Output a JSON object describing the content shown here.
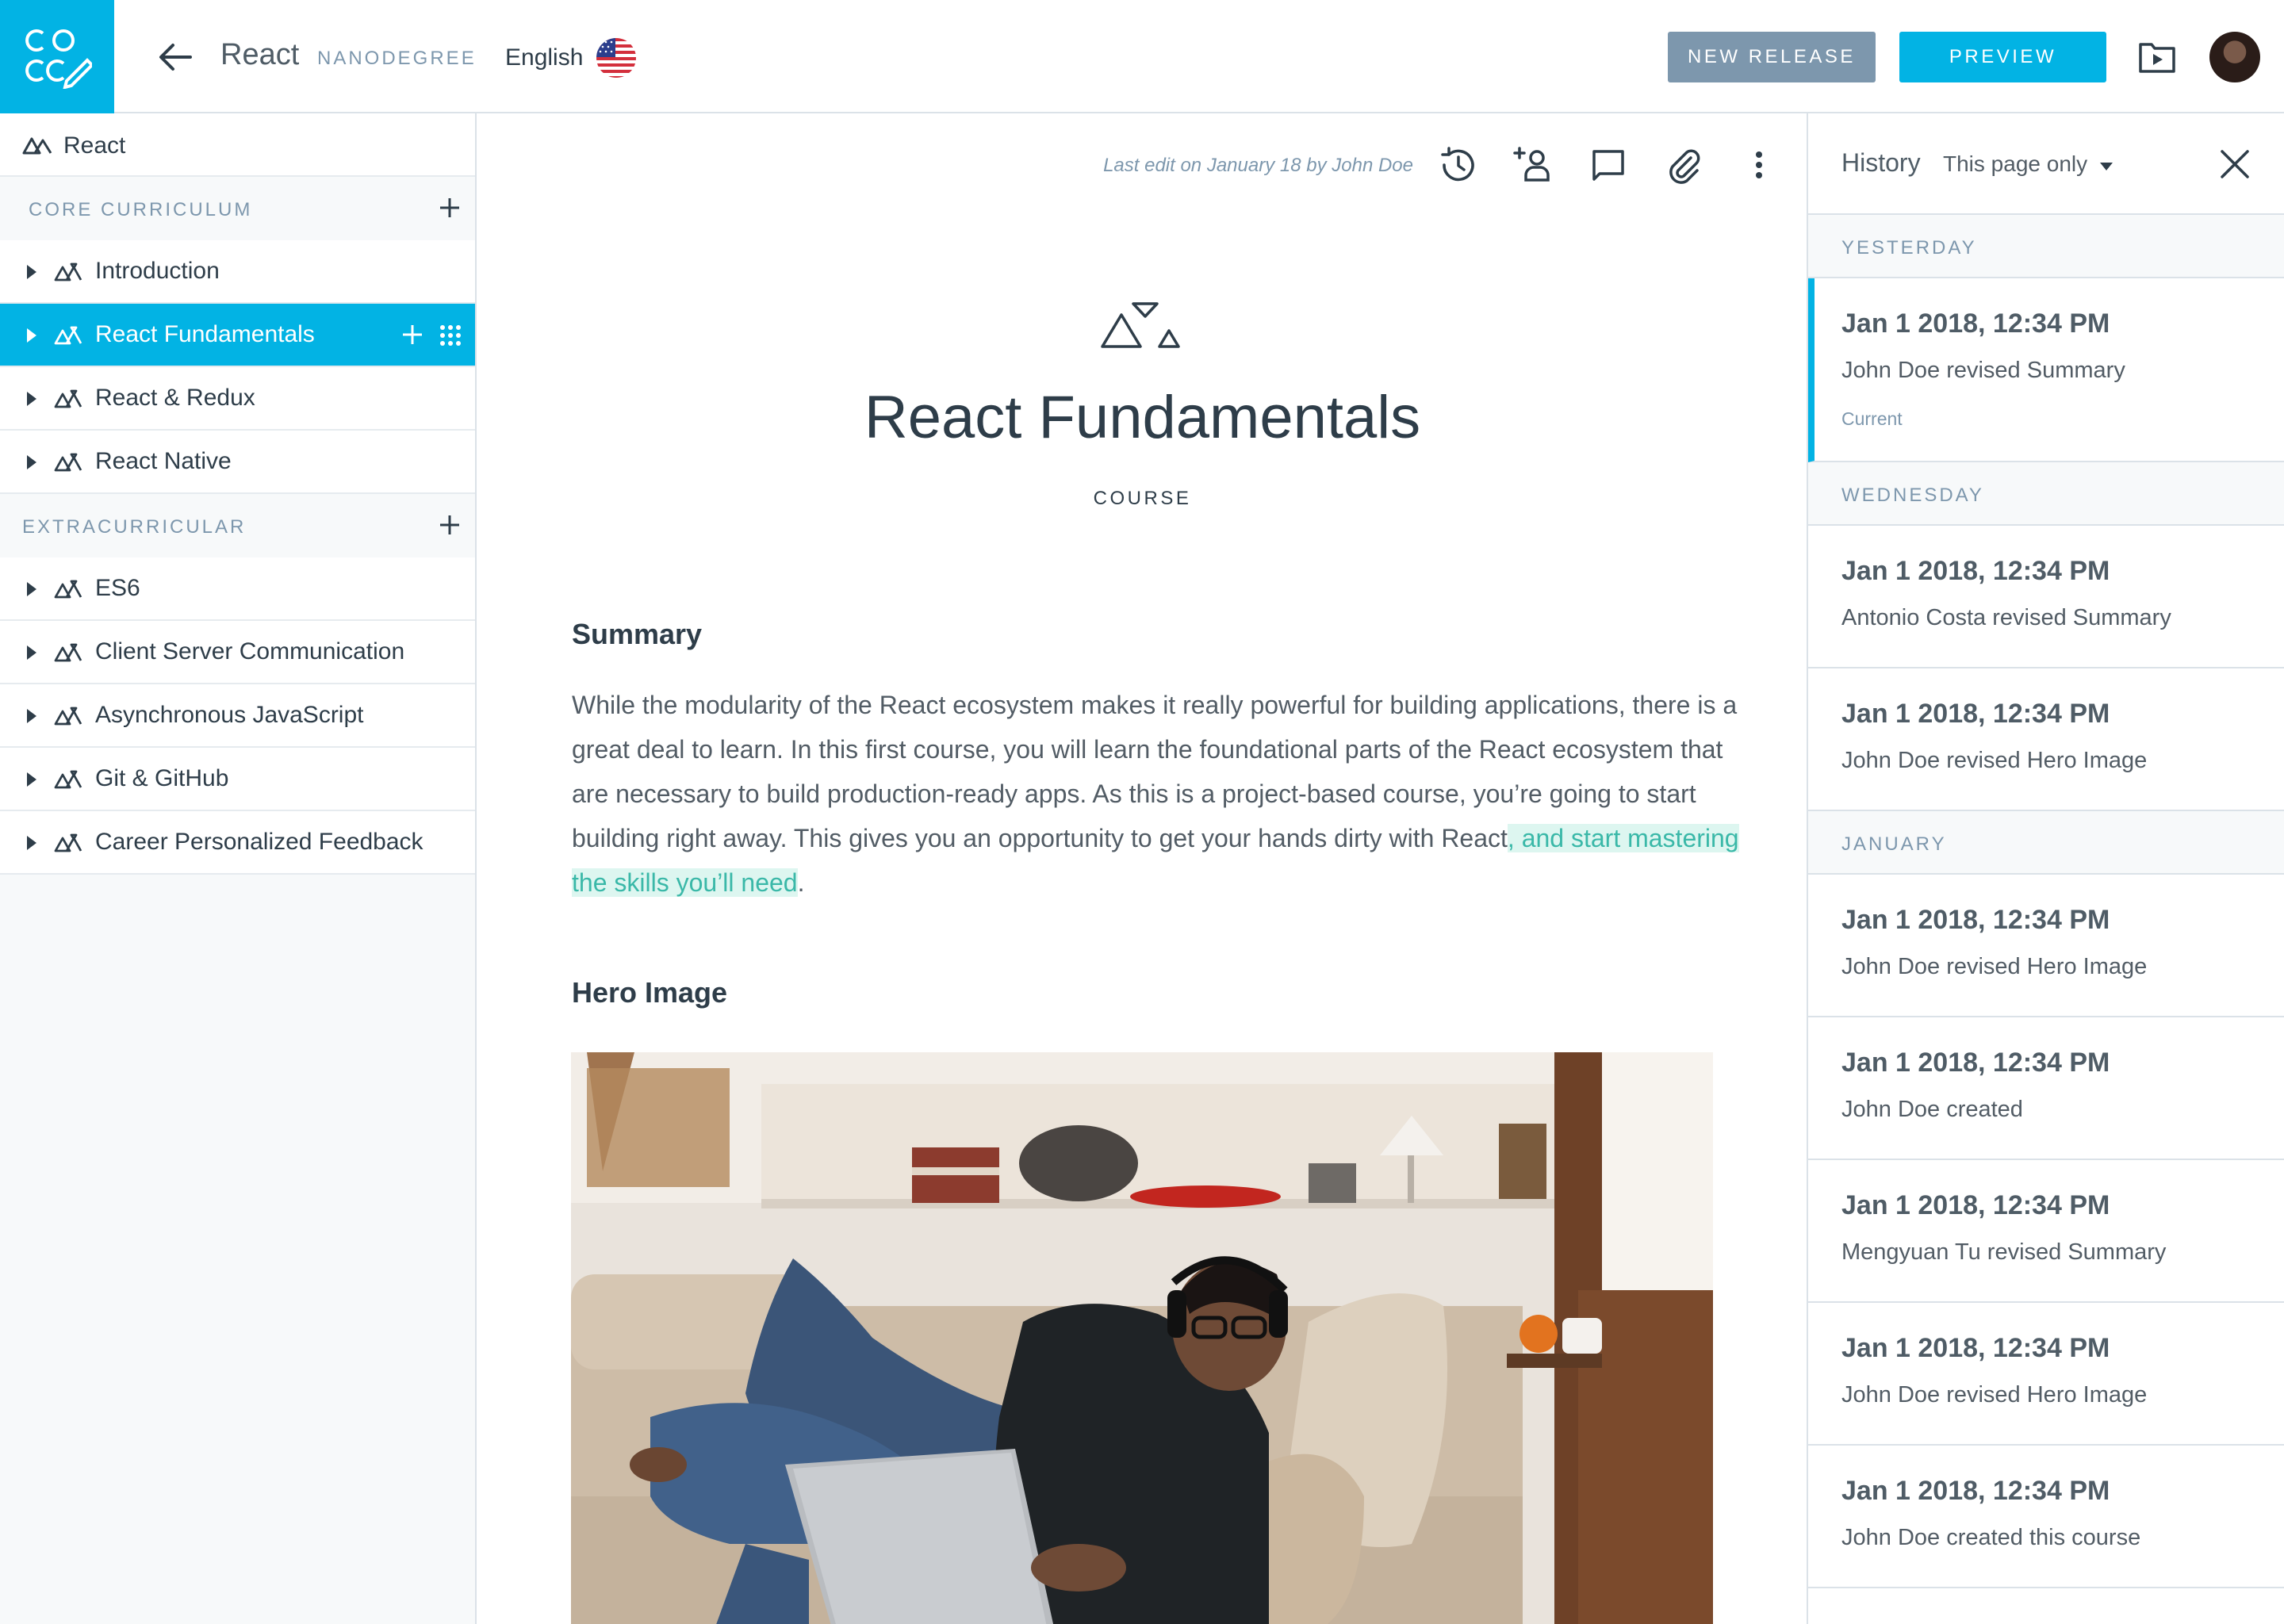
{
  "header": {
    "logo_text": "CO CC",
    "breadcrumb_title": "React",
    "breadcrumb_subtitle": "NANODEGREE",
    "language": "English",
    "new_release_label": "NEW RELEASE",
    "preview_label": "PREVIEW"
  },
  "sidebar": {
    "root_label": "React",
    "sections": [
      {
        "label": "CORE CURRICULUM",
        "items": [
          "Introduction",
          "React Fundamentals",
          "React & Redux",
          "React Native"
        ]
      },
      {
        "label": "EXTRACURRICULAR",
        "items": [
          "ES6",
          "Client Server Communication",
          "Asynchronous JavaScript",
          "Git & GitHub",
          "Career Personalized Feedback"
        ]
      }
    ],
    "active_item": "React Fundamentals"
  },
  "main": {
    "last_edit": "Last edit on January 18 by John Doe",
    "course_title": "React Fundamentals",
    "course_type": "COURSE",
    "summary_heading": "Summary",
    "summary_text": "While the modularity of the React ecosystem makes it really powerful for building applications, there is a great deal to learn. In this first course, you will learn the foundational parts of the React ecosystem that are necessary to build production-ready apps. As this is a project-based course, you’re going to start building right away. This gives you an opportunity to get your hands dirty with React",
    "summary_highlight": ", and start mastering the skills you’ll need",
    "summary_end": ".",
    "hero_heading": "Hero Image"
  },
  "history": {
    "title": "History",
    "filter": "This page only",
    "groups": [
      {
        "label": "YESTERDAY",
        "entries": [
          {
            "date": "Jan 1 2018, 12:34 PM",
            "desc": "John Doe revised Summary",
            "current_label": "Current"
          }
        ]
      },
      {
        "label": "WEDNESDAY",
        "entries": [
          {
            "date": "Jan 1 2018, 12:34 PM",
            "desc": "Antonio Costa revised Summary"
          },
          {
            "date": "Jan 1 2018, 12:34 PM",
            "desc": "John Doe revised Hero Image"
          }
        ]
      },
      {
        "label": "JANUARY",
        "entries": [
          {
            "date": "Jan 1 2018, 12:34 PM",
            "desc": "John Doe revised Hero Image"
          },
          {
            "date": "Jan 1 2018, 12:34 PM",
            "desc": "John Doe created"
          },
          {
            "date": "Jan 1 2018, 12:34 PM",
            "desc": "Mengyuan Tu revised Summary"
          },
          {
            "date": "Jan 1 2018, 12:34 PM",
            "desc": "John Doe revised Hero Image"
          },
          {
            "date": "Jan 1 2018, 12:34 PM",
            "desc": "John Doe created this course"
          }
        ]
      }
    ]
  },
  "icons": {
    "back": "arrow-left-icon",
    "flag": "us-flag-icon",
    "folder": "folder-play-icon",
    "history": "history-icon",
    "add_user": "add-user-icon",
    "comment": "comment-icon",
    "attach": "paperclip-icon",
    "more": "more-vertical-icon",
    "course": "triangles-icon",
    "close": "close-icon"
  },
  "colors": {
    "brand": "#02b3e4",
    "release_button": "#7d97ad",
    "text_dark": "#2e3d49",
    "muted": "#7d97ad",
    "highlight_bg": "#ddf6f0",
    "highlight_text": "#3ab8a8"
  }
}
